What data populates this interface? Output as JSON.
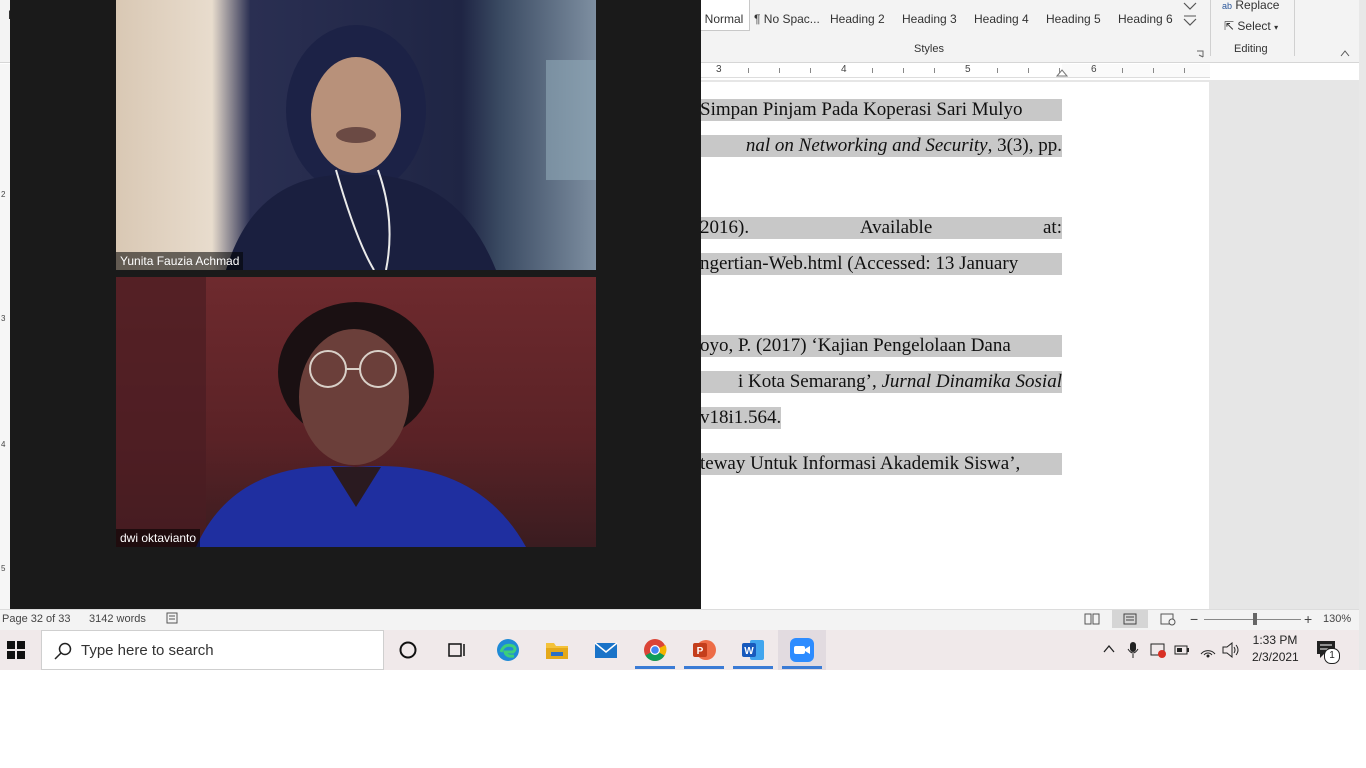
{
  "ribbon": {
    "styles": [
      "Normal",
      "¶ No Spac...",
      "Heading 2",
      "Heading 3",
      "Heading 4",
      "Heading 5",
      "Heading 6"
    ],
    "styles_group_label": "Styles",
    "editing": {
      "replace_label": "Replace",
      "select_label": "Select",
      "group_label": "Editing"
    }
  },
  "ruler": {
    "numbers": [
      "3",
      "4",
      "5",
      "6"
    ]
  },
  "vertical_ruler": {
    "numbers": [
      "2",
      "3",
      "4",
      "5"
    ]
  },
  "document": {
    "lines": [
      {
        "text": "Simpan Pinjam Pada Koperasi Sari Mulyo"
      },
      {
        "pre": "",
        "italic": "nal on Networking and Security",
        "post": ", 3(3), pp."
      },
      {
        "words": [
          "2016).",
          "Available",
          "at:"
        ]
      },
      {
        "text": "ngertian-Web.html (Accessed: 13 January"
      },
      {
        "text": "oyo, P. (2017) ‘Kajian Pengelolaan Dana"
      },
      {
        "pre": "i Kota Semarang’, ",
        "italic": "Jurnal Dinamika Sosial",
        "post": ""
      },
      {
        "text": "v18i1.564."
      },
      {
        "text": "teway Untuk Informasi Akademik Siswa’,"
      }
    ]
  },
  "zoom": {
    "participants": [
      {
        "name": "Yunita Fauzia Achmad"
      },
      {
        "name": "dwi oktavianto"
      }
    ]
  },
  "statusbar": {
    "page": "Page 32 of 33",
    "words": "3142 words",
    "zoom": "130%"
  },
  "taskbar": {
    "search_placeholder": "Type here to search",
    "time": "1:33 PM",
    "date": "2/3/2021",
    "notification_count": "1"
  },
  "colors": {
    "word_blue": "#2b579a",
    "highlight_gray": "#c8c8c8",
    "zoom_bg": "#1a1a1a",
    "taskbar_bg": "#f0e9ea"
  }
}
